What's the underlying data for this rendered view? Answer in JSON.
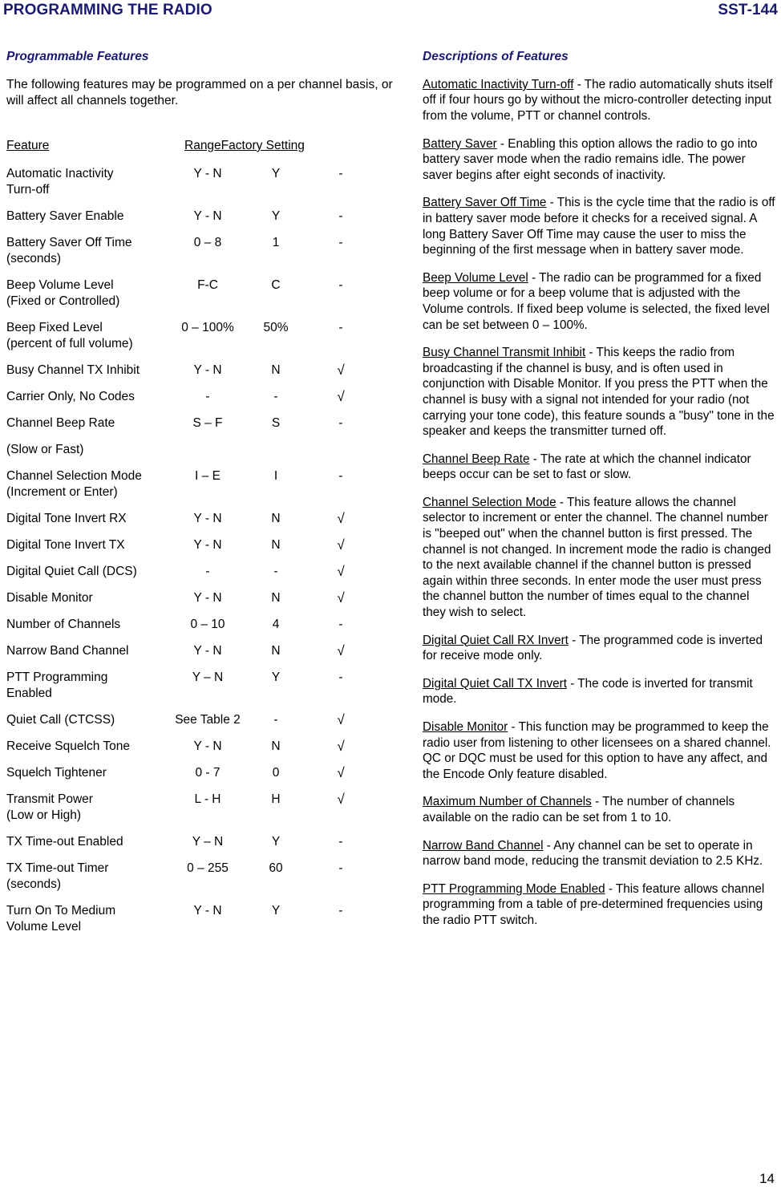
{
  "running_head": {
    "left": "PROGRAMMING THE RADIO",
    "right": "SST-144",
    "color": "#191970"
  },
  "left_column": {
    "heading": "Programmable Features",
    "intro": "The following features may be programmed on a per channel basis, or will affect all channels together.",
    "table": {
      "headers": {
        "feature": "Feature",
        "range_factory": "RangeFactory Setting"
      },
      "rows": [
        {
          "name": "Automatic Inactivity",
          "sub": "Turn-off",
          "range": "Y - N",
          "factory": "Y",
          "mark": "-"
        },
        {
          "name": "Battery Saver Enable",
          "sub": "",
          "range": "Y - N",
          "factory": "Y",
          "mark": "-"
        },
        {
          "name": "Battery Saver Off Time",
          "sub": "(seconds)",
          "range": "0 – 8",
          "factory": "1",
          "mark": "-"
        },
        {
          "name": "Beep Volume Level",
          "sub": "(Fixed or Controlled)",
          "range": "F-C",
          "factory": "C",
          "mark": "-"
        },
        {
          "name": "Beep Fixed Level",
          "sub": "(percent of full volume)",
          "range": "0 – 100%",
          "factory": "50%",
          "mark": "-"
        },
        {
          "name": "Busy Channel TX Inhibit",
          "sub": "",
          "range": "Y - N",
          "factory": "N",
          "mark": "√"
        },
        {
          "name": "Carrier Only, No Codes",
          "sub": "",
          "range": "-",
          "factory": "-",
          "mark": "√"
        },
        {
          "name": "Channel Beep Rate",
          "sub": "",
          "standalone_sub": "(Slow or Fast)",
          "range": "S – F",
          "factory": "S",
          "mark": "-"
        },
        {
          "name": "Channel Selection Mode",
          "sub": "(Increment or Enter)",
          "range": "I – E",
          "factory": "I",
          "mark": "-"
        },
        {
          "name": "Digital Tone Invert RX",
          "sub": "",
          "range": "Y - N",
          "factory": "N",
          "mark": "√"
        },
        {
          "name": "Digital Tone Invert TX",
          "sub": "",
          "range": "Y - N",
          "factory": "N",
          "mark": "√"
        },
        {
          "name": "Digital Quiet Call (DCS)",
          "sub": "",
          "range": "-",
          "factory": "-",
          "mark": "√"
        },
        {
          "name": "Disable Monitor",
          "sub": "",
          "range": "Y - N",
          "factory": "N",
          "mark": "√"
        },
        {
          "name": "Number of Channels",
          "sub": "",
          "range": "0 – 10",
          "factory": "4",
          "mark": "-"
        },
        {
          "name": "Narrow Band Channel",
          "sub": "",
          "range": "Y - N",
          "factory": "N",
          "mark": "√"
        },
        {
          "name": "PTT Programming",
          "sub": "Enabled",
          "range": "Y – N",
          "factory": "Y",
          "mark": "-"
        },
        {
          "name": "Quiet Call (CTCSS)",
          "sub": "",
          "range": "See Table 2",
          "factory": "-",
          "mark": "√"
        },
        {
          "name": "Receive Squelch Tone",
          "sub": "",
          "range": "Y - N",
          "factory": "N",
          "mark": "√"
        },
        {
          "name": "Squelch Tightener",
          "sub": "",
          "range": "0 - 7",
          "factory": "0",
          "mark": "√"
        },
        {
          "name": "Transmit Power",
          "sub": "(Low or High)",
          "range": "L - H",
          "factory": "H",
          "mark": "√"
        },
        {
          "name": "TX Time-out Enabled",
          "sub": "",
          "range": "Y – N",
          "factory": "Y",
          "mark": "-"
        },
        {
          "name": "TX Time-out Timer",
          "sub": "(seconds)",
          "range": "0 – 255",
          "factory": "60",
          "mark": "-"
        },
        {
          "name": "Turn On To Medium",
          "sub": "Volume Level",
          "range": "Y - N",
          "factory": "Y",
          "mark": "-"
        }
      ]
    }
  },
  "right_column": {
    "heading": "Descriptions of Features",
    "descriptions": [
      {
        "term": "Automatic Inactivity Turn-off",
        "text": " - The radio automatically shuts itself off if four hours go by without the micro-controller detecting input from the volume, PTT or channel controls."
      },
      {
        "term": "Battery Saver",
        "text": " - Enabling this option allows the radio to go into battery saver mode when the radio remains idle.  The power saver begins after eight seconds of inactivity."
      },
      {
        "term": "Battery Saver Off Time",
        "text": " - This is the cycle time that the radio is off in battery saver mode before it checks for a received signal.  A long Battery Saver Off Time may cause the user to miss the beginning of the first message when in battery saver mode."
      },
      {
        "term": "Beep Volume Level",
        "text": " - The radio can be programmed for a fixed beep volume or for a beep volume that is adjusted with the Volume controls.  If fixed beep volume is selected, the fixed level can be set between 0 – 100%."
      },
      {
        "term": "Busy Channel Transmit Inhibit",
        "text": " - This keeps the radio from broadcasting if the channel is busy, and is often used in conjunction with Disable Monitor.  If you press the PTT when the channel is busy with a signal not intended for your radio (not carrying your tone code), this feature sounds a \"busy\" tone in the speaker and keeps the transmitter turned off."
      },
      {
        "term": "Channel Beep Rate",
        "text": " - The rate at which the channel indicator beeps occur can be set to fast or slow."
      },
      {
        "term": "Channel Selection Mode",
        "text": " - This feature allows the channel selector to increment or enter the channel. The channel number is \"beeped out\" when the channel button is first pressed. The channel is not changed. In increment mode the radio is changed to the next available channel if the channel button is pressed again within three seconds.  In enter mode the user must press the channel button the number of times equal to the channel they wish to select."
      },
      {
        "term": "Digital Quiet Call RX Invert",
        "text": " - The programmed code is inverted for receive mode only."
      },
      {
        "term": "Digital Quiet Call TX Invert",
        "text": " - The code is inverted for transmit mode."
      },
      {
        "term": "Disable Monitor",
        "text": " - This function may be programmed to keep the radio user from listening to other licensees on a shared channel.  QC or DQC must be used for this option to have any affect, and the Encode Only feature disabled."
      },
      {
        "term": "Maximum Number of Channels",
        "text": " - The number of channels available on the radio can be set from 1 to 10."
      },
      {
        "term": "Narrow Band Channel",
        "text": " - Any channel can be set to operate in narrow band mode, reducing the transmit deviation to 2.5 KHz."
      },
      {
        "term": "PTT Programming Mode Enabled",
        "text": " - This feature allows channel programming from a table of pre-determined frequencies using the radio PTT switch."
      }
    ]
  },
  "page_number": "14"
}
